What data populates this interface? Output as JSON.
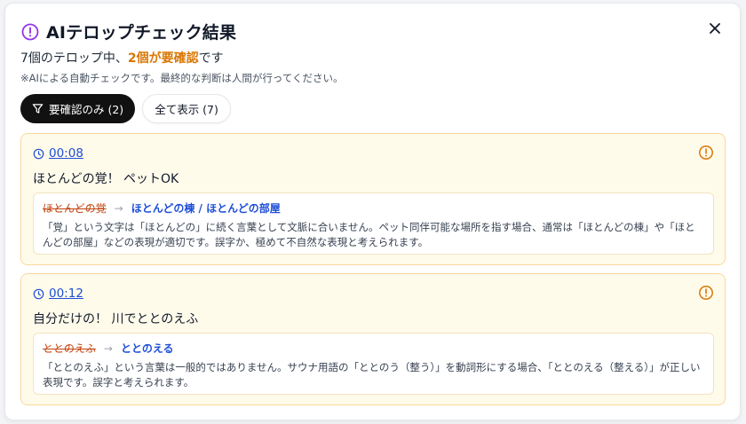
{
  "dialog": {
    "title": "AIテロップチェック結果",
    "summary_pre": "7個のテロップ中、",
    "summary_highlight": "2個が要確認",
    "summary_post": "です",
    "note": "※AIによる自動チェックです。最終的な判断は人間が行ってください。",
    "close_icon": "close-icon"
  },
  "filters": [
    {
      "label": "要確認のみ (2)",
      "active": true,
      "icon": "filter-icon"
    },
    {
      "label": "全て表示 (7)",
      "active": false
    }
  ],
  "items": [
    {
      "timestamp": "00:08",
      "caption": "ほとんどの覚！ ペットOK",
      "original": "ほとんどの覚",
      "arrow": "→",
      "suggestion": "ほとんどの棟 / ほとんどの部屋",
      "reason": "「覚」という文字は「ほとんどの」に続く言葉として文脈に合いません。ペット同伴可能な場所を指す場合、通常は「ほとんどの棟」や「ほとんどの部屋」などの表現が適切です。誤字か、極めて不自然な表現と考えられます。"
    },
    {
      "timestamp": "00:12",
      "caption": "自分だけの！ 川でととのえふ",
      "original": "ととのえふ",
      "arrow": "→",
      "suggestion": "ととのえる",
      "reason": "「ととのえふ」という言葉は一般的ではありません。サウナ用語の「ととのう（整う）」を動詞形にする場合、「ととのえる（整える）」が正しい表現です。誤字と考えられます。"
    }
  ],
  "colors": {
    "accent_purple": "#9333ea",
    "warning_amber": "#d97706",
    "link_blue": "#1d4ed8",
    "strike_orange": "#c2410c"
  }
}
